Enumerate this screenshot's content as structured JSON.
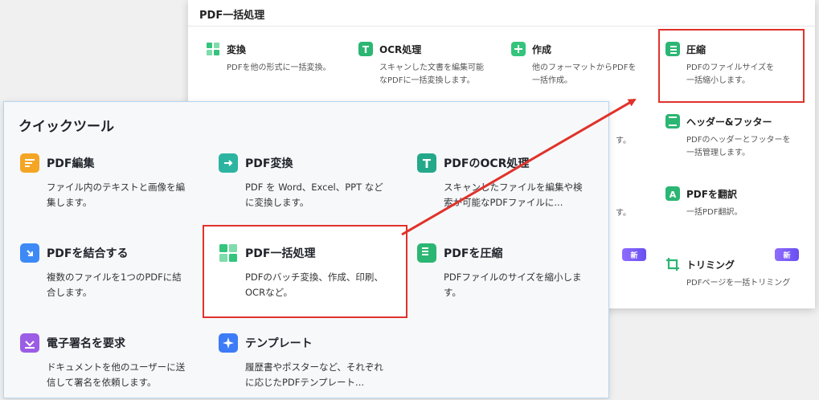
{
  "back_panel": {
    "title": "PDF一括処理",
    "items": [
      {
        "label": "変換",
        "desc": "PDFを他の形式に一括変換。",
        "icon": "convert-grid-icon",
        "color": "#34c47c"
      },
      {
        "label": "OCR処理",
        "desc": "スキャンした文書を編集可能なPDFに一括変換します。",
        "icon": "ocr-t-icon",
        "color": "#2bb673"
      },
      {
        "label": "作成",
        "desc": "他のフォーマットからPDFを一括作成。",
        "icon": "create-plus-icon",
        "color": "#34c47c"
      },
      {
        "label": "圧縮",
        "desc": "PDFのファイルサイズを一括縮小します。",
        "icon": "compress-icon",
        "color": "#2bb673"
      },
      {
        "label": "ヘッダー&フッター",
        "desc": "PDFのヘッダーとフッターを一括管理します。",
        "icon": "header-footer-icon",
        "color": "#2bb673"
      },
      {
        "label": "PDFを翻訳",
        "desc": "一括PDF翻訳。",
        "icon": "translate-icon",
        "color": "#2bb673"
      },
      {
        "label": "トリミング",
        "desc": "PDFページを一括トリミング",
        "icon": "crop-icon",
        "color": "#2bb673"
      }
    ],
    "fragments": [
      "す。",
      "す。"
    ],
    "badges": [
      "新",
      "新"
    ]
  },
  "front_panel": {
    "title": "クイックツール",
    "items": [
      {
        "label": "PDF編集",
        "desc": "ファイル内のテキストと画像を編集します。",
        "icon": "edit-pdf-icon",
        "color": "#f5a524"
      },
      {
        "label": "PDF変換",
        "desc": "PDF を Word、Excel、PPT などに変換します。",
        "icon": "convert-pdf-icon",
        "color": "#2bb5a0"
      },
      {
        "label": "PDFのOCR処理",
        "desc": "スキャンしたファイルを編集や検索が可能なPDFファイルに...",
        "icon": "ocr-pdf-icon",
        "color": "#23a889"
      },
      {
        "label": "PDFを結合する",
        "desc": "複数のファイルを1つのPDFに結合します。",
        "icon": "merge-pdf-icon",
        "color": "#3d8af7"
      },
      {
        "label": "PDF一括処理",
        "desc": "PDFのバッチ変換、作成、印刷、OCRなど。",
        "icon": "batch-process-icon",
        "color": "#34c47c"
      },
      {
        "label": "PDFを圧縮",
        "desc": "PDFファイルのサイズを縮小します。",
        "icon": "compress-pdf-icon",
        "color": "#2bb673"
      },
      {
        "label": "電子署名を要求",
        "desc": "ドキュメントを他のユーザーに送信して署名を依頼します。",
        "icon": "esign-icon",
        "color": "#9b5de5"
      },
      {
        "label": "テンプレート",
        "desc": "履歴書やポスターなど、それぞれに応じたPDFテンプレート...",
        "icon": "template-icon",
        "color": "#3d7bf7"
      }
    ]
  },
  "colors": {
    "highlight": "#e0322b",
    "badge": "#7a5cf5"
  }
}
